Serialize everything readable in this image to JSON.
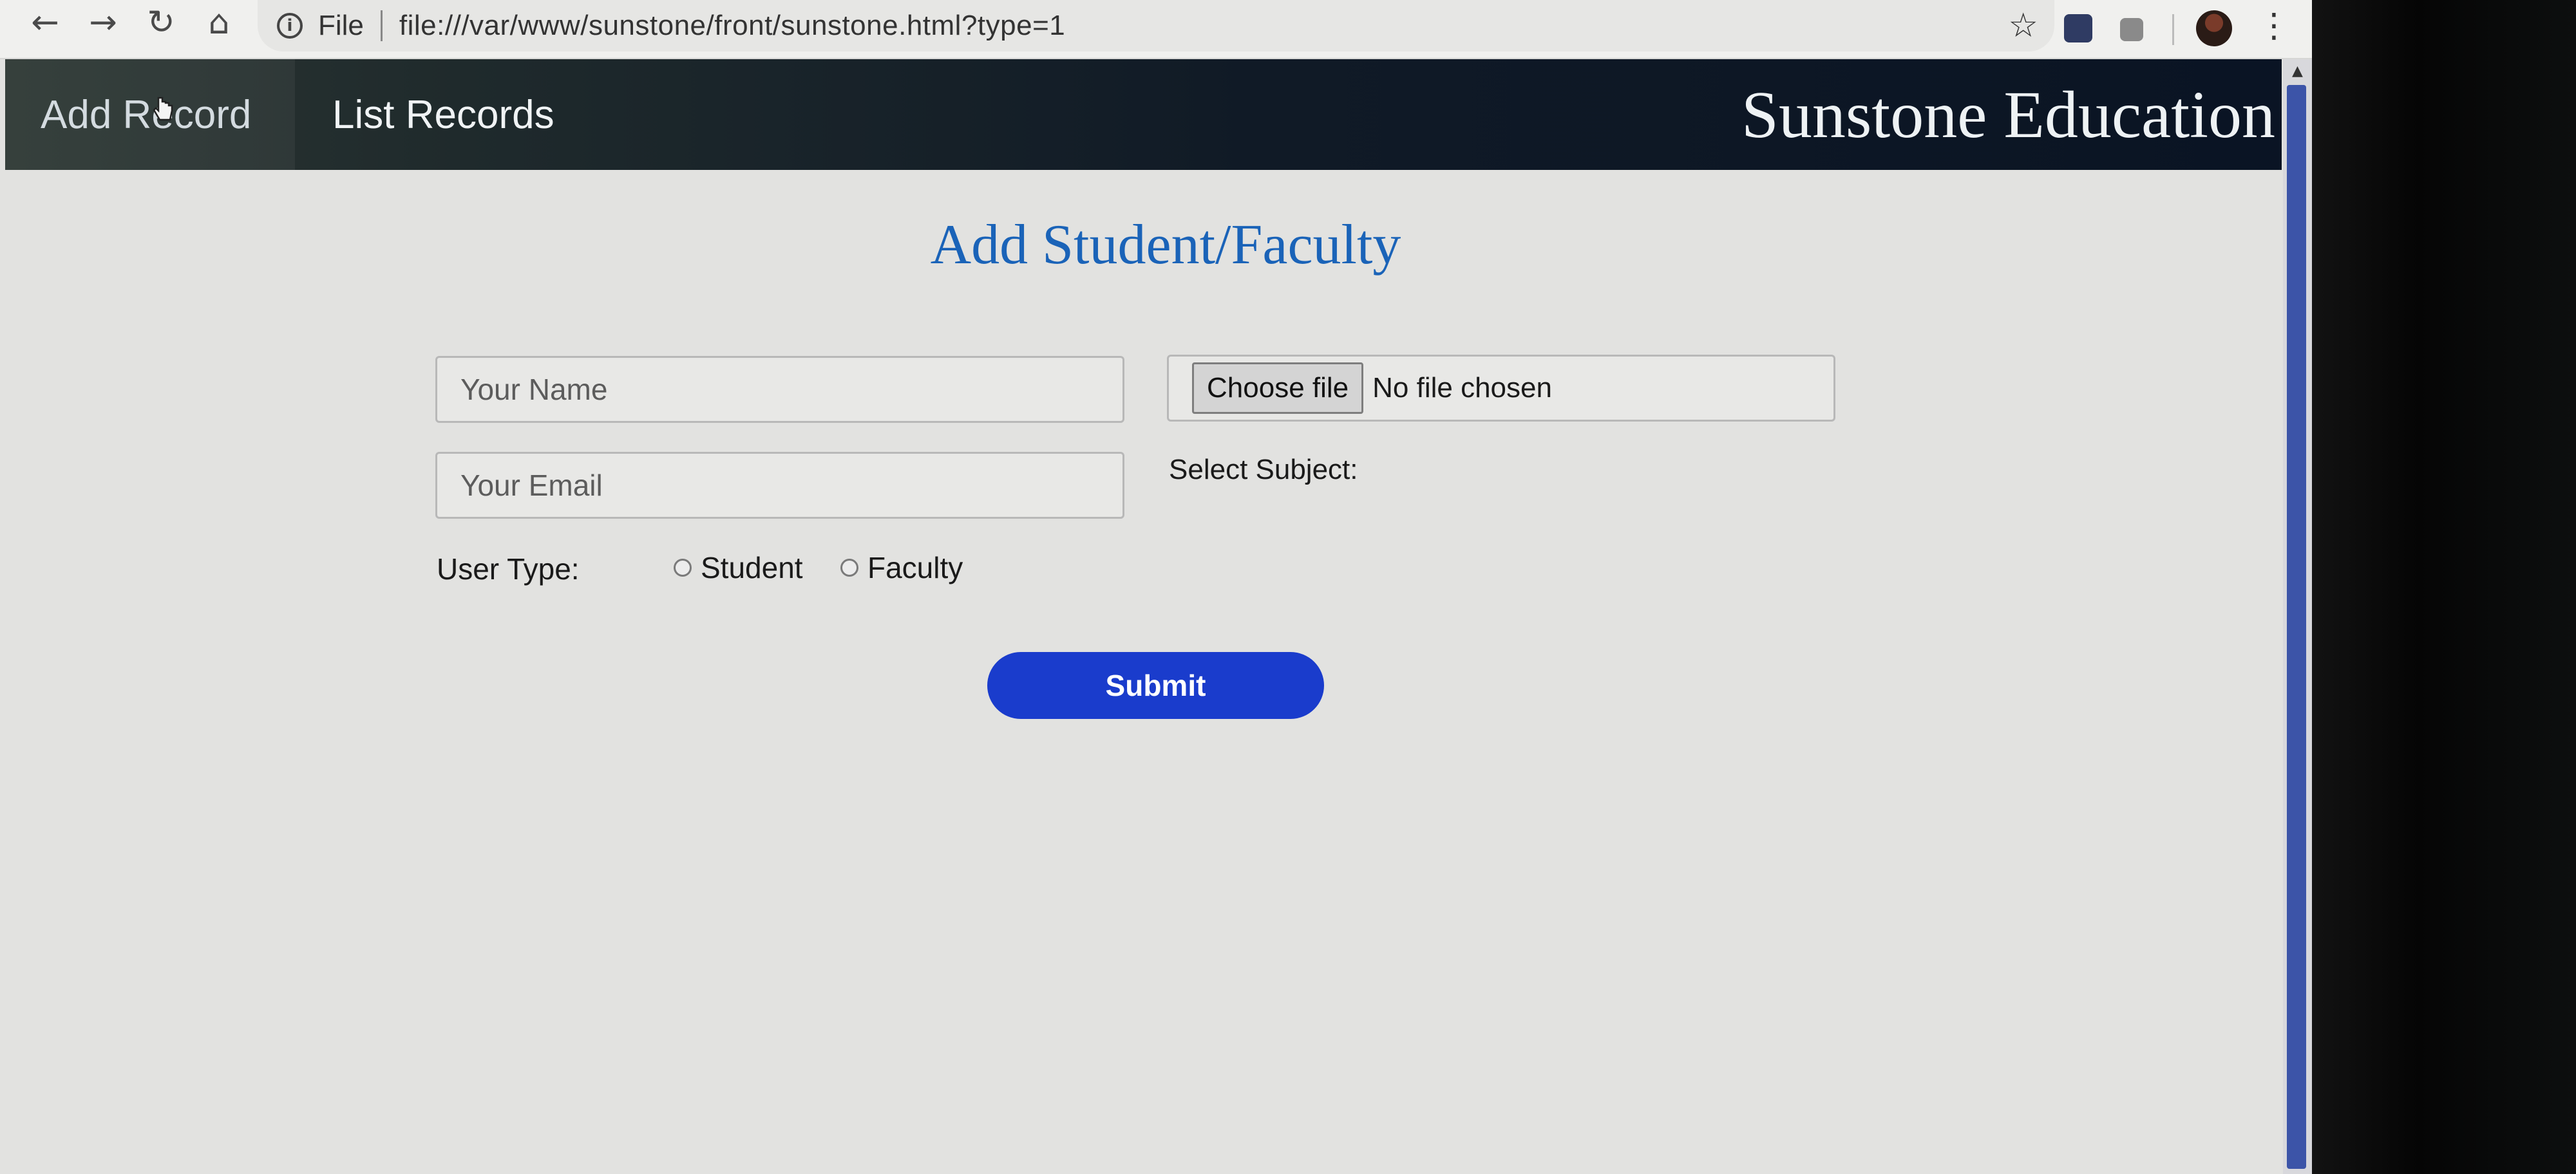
{
  "browser": {
    "scheme_label": "File",
    "url": "file:///var/www/sunstone/front/sunstone.html?type=1",
    "icons": [
      "back-icon",
      "forward-icon",
      "reload-icon",
      "home-icon",
      "info-icon",
      "bookmark-star-icon",
      "extension-icon",
      "profile-avatar",
      "menu-icon"
    ]
  },
  "header": {
    "nav": [
      {
        "label": "Add Record",
        "active": true
      },
      {
        "label": "List Records",
        "active": false
      }
    ],
    "brand": "Sunstone Education"
  },
  "form": {
    "title": "Add Student/Faculty",
    "name_placeholder": "Your Name",
    "email_placeholder": "Your Email",
    "file_button_label": "Choose file",
    "file_status": "No file chosen",
    "subject_label": "Select Subject:",
    "user_type_label": "User Type:",
    "user_type_options": [
      "Student",
      "Faculty"
    ],
    "submit_label": "Submit"
  },
  "colors": {
    "header_bg": "#101a26",
    "title": "#1a63b8",
    "submit_bg": "#1a3ccc",
    "page_bg": "#e2e2e0"
  }
}
